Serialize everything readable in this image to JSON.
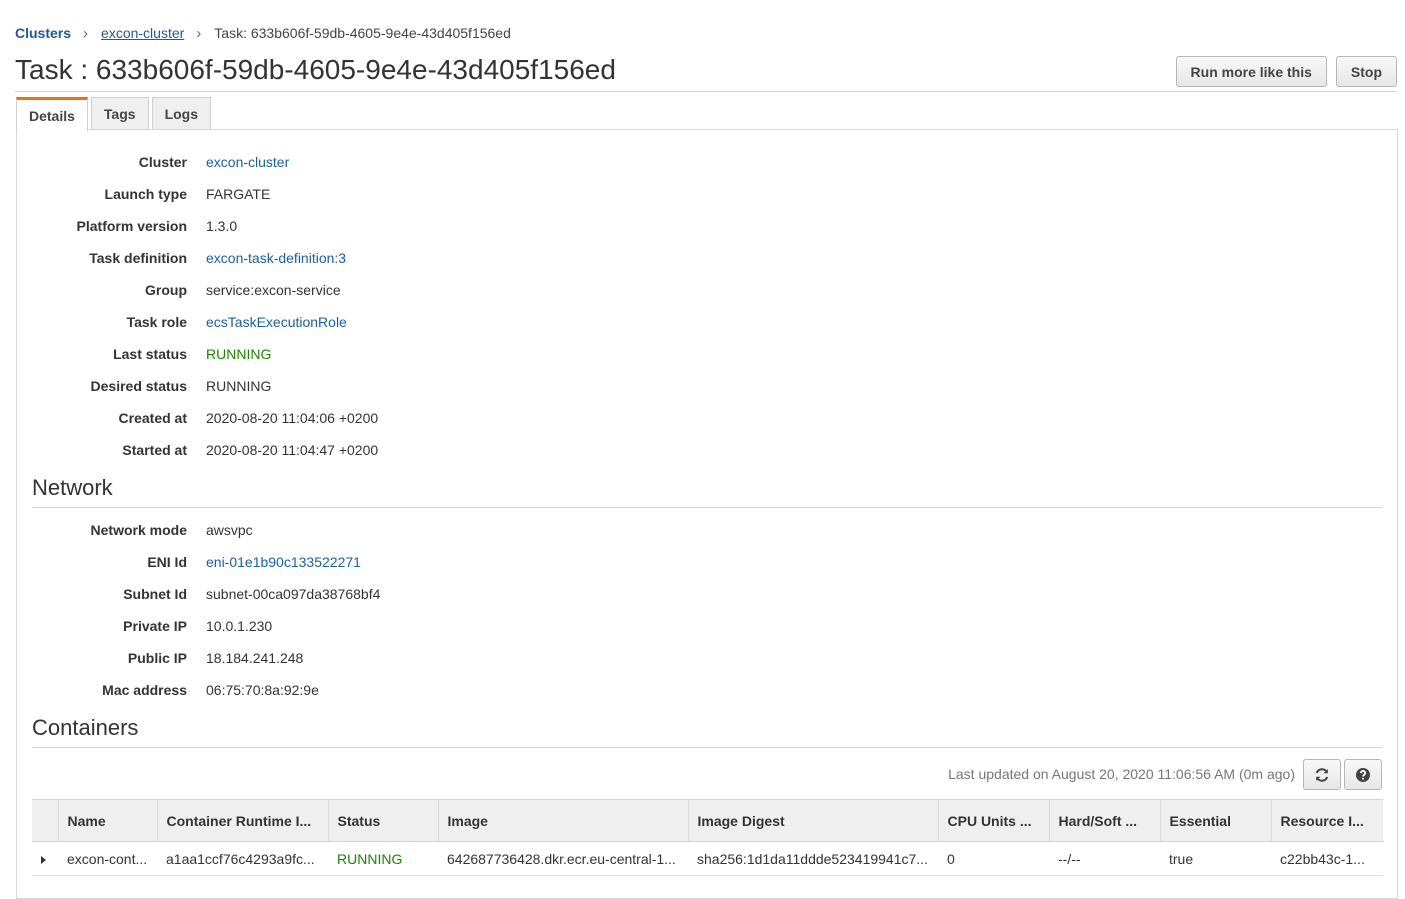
{
  "breadcrumb": {
    "clusters": "Clusters",
    "cluster": "excon-cluster",
    "current": "Task: 633b606f-59db-4605-9e4e-43d405f156ed"
  },
  "title": "Task : 633b606f-59db-4605-9e4e-43d405f156ed",
  "actions": {
    "run_more": "Run more like this",
    "stop": "Stop"
  },
  "tabs": [
    "Details",
    "Tags",
    "Logs"
  ],
  "details": [
    {
      "label": "Cluster",
      "value": "excon-cluster",
      "style": "link"
    },
    {
      "label": "Launch type",
      "value": "FARGATE",
      "style": "plain"
    },
    {
      "label": "Platform version",
      "value": "1.3.0",
      "style": "plain"
    },
    {
      "label": "Task definition",
      "value": "excon-task-definition:3",
      "style": "link"
    },
    {
      "label": "Group",
      "value": "service:excon-service",
      "style": "plain"
    },
    {
      "label": "Task role",
      "value": "ecsTaskExecutionRole",
      "style": "link"
    },
    {
      "label": "Last status",
      "value": "RUNNING",
      "style": "status"
    },
    {
      "label": "Desired status",
      "value": "RUNNING",
      "style": "plain"
    },
    {
      "label": "Created at",
      "value": "2020-08-20 11:04:06 +0200",
      "style": "plain"
    },
    {
      "label": "Started at",
      "value": "2020-08-20 11:04:47 +0200",
      "style": "plain"
    }
  ],
  "network": {
    "title": "Network",
    "rows": [
      {
        "label": "Network mode",
        "value": "awsvpc",
        "style": "plain"
      },
      {
        "label": "ENI Id",
        "value": "eni-01e1b90c133522271",
        "style": "link"
      },
      {
        "label": "Subnet Id",
        "value": "subnet-00ca097da38768bf4",
        "style": "plain"
      },
      {
        "label": "Private IP",
        "value": "10.0.1.230",
        "style": "plain"
      },
      {
        "label": "Public IP",
        "value": "18.184.241.248",
        "style": "plain"
      },
      {
        "label": "Mac address",
        "value": "06:75:70:8a:92:9e",
        "style": "plain"
      }
    ]
  },
  "containers": {
    "title": "Containers",
    "last_updated": "Last updated on August 20, 2020 11:06:56 AM (0m ago)",
    "columns": [
      "Name",
      "Container Runtime I...",
      "Status",
      "Image",
      "Image Digest",
      "CPU Units ...",
      "Hard/Soft ...",
      "Essential",
      "Resource I..."
    ],
    "rows": [
      [
        "excon-cont...",
        "a1aa1ccf76c4293a9fc...",
        "RUNNING",
        "642687736428.dkr.ecr.eu-central-1...",
        "sha256:1d1da11ddde523419941c7...",
        "0",
        "--/--",
        "true",
        "c22bb43c-1..."
      ]
    ]
  },
  "colors": {
    "link": "#1a5fa8",
    "running": "#1d8102",
    "tab_accent": "#ec7211"
  },
  "icons": {
    "refresh": "refresh-icon",
    "help": "help-icon",
    "expand": "caret-right-icon",
    "separator": "chevron-right-icon"
  }
}
